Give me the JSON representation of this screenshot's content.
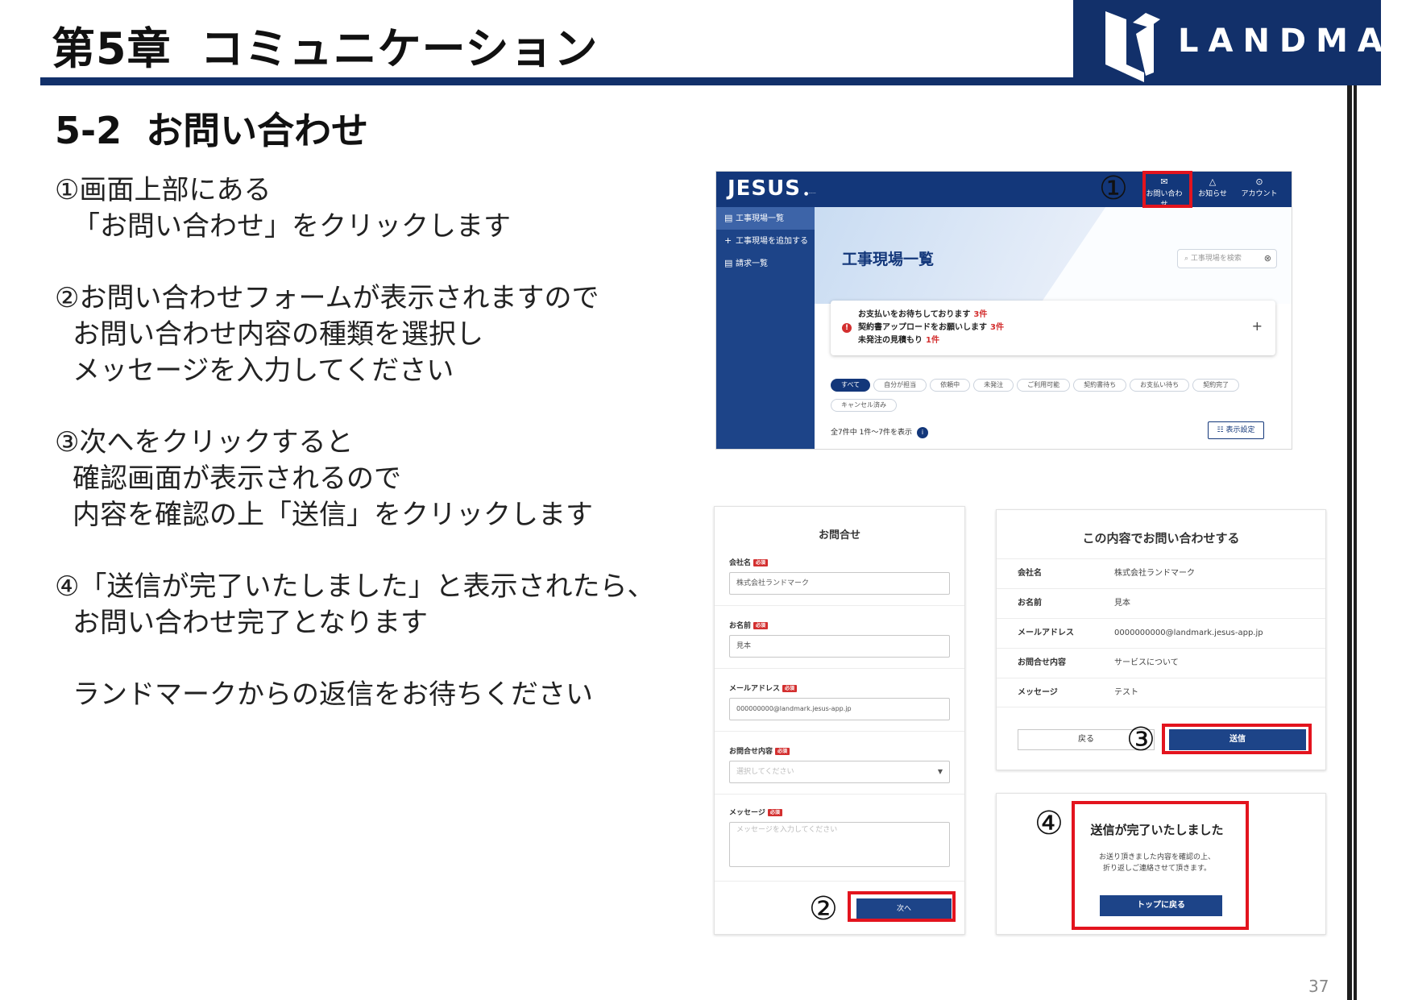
{
  "header": {
    "chapter_no": "第5章",
    "chapter_title": "コミュニケーション",
    "logo_text": "LANDMARK"
  },
  "section": {
    "no": "5-2",
    "title": "お問い合わせ"
  },
  "steps": [
    {
      "lines": [
        "①画面上部にある",
        "「お問い合わせ」をクリックします"
      ]
    },
    {
      "lines": [
        "②お問い合わせフォームが表示されますので",
        "お問い合わせ内容の種類を選択し",
        "メッセージを入力してください"
      ]
    },
    {
      "lines": [
        "③次へをクリックすると",
        "確認画面が表示されるので",
        "内容を確認の上「送信」をクリックします"
      ]
    },
    {
      "lines": [
        "④「送信が完了いたしました」と表示されたら、",
        "お問い合わせ完了となります"
      ]
    },
    {
      "lines": [
        "ランドマークからの返信をお待ちください"
      ]
    }
  ],
  "markers": {
    "m1": "①",
    "m2": "②",
    "m3": "③",
    "m4": "④"
  },
  "app": {
    "logo": "JESUS",
    "nav": [
      {
        "icon": "mail-icon",
        "glyph": "✉",
        "label": "お問い合わせ"
      },
      {
        "icon": "bell-icon",
        "glyph": "♫",
        "label": "お知らせ"
      },
      {
        "icon": "account-icon",
        "glyph": "⊙",
        "label": "アカウント"
      }
    ],
    "sidebar": [
      {
        "glyph": "▤",
        "label": "工事現場一覧"
      },
      {
        "glyph": "+",
        "label": "工事現場を追加する"
      },
      {
        "glyph": "▤",
        "label": "請求一覧"
      }
    ],
    "page_title": "工事現場一覧",
    "search_placeholder": "工事現場を検索",
    "alert": {
      "lines": [
        {
          "text": "お支払いをお待ちしております",
          "count": "3件"
        },
        {
          "text": "契約書アップロードをお願いします",
          "count": "3件"
        },
        {
          "text": "未発注の見積もり",
          "count": "1件"
        }
      ]
    },
    "chips": [
      "すべて",
      "自分が担当",
      "依頼中",
      "未発注",
      "ご利用可能",
      "契約書待ち",
      "お支払い待ち",
      "契約完了",
      "キャンセル済み"
    ],
    "count_text": "全7件中 1件〜7件を表示",
    "count_badge": "i",
    "display_settings": "☷ 表示設定"
  },
  "form": {
    "title": "お問合せ",
    "required": "必須",
    "company_label": "会社名",
    "company_value": "株式会社ランドマーク",
    "name_label": "お名前",
    "name_value": "見本",
    "email_label": "メールアドレス",
    "email_value": "000000000@landmark.jesus-app.jp",
    "type_label": "お問合せ内容",
    "type_placeholder": "選択してください",
    "message_label": "メッセージ",
    "message_placeholder": "メッセージを入力してください",
    "next_button": "次へ"
  },
  "confirm": {
    "title": "この内容でお問い合わせする",
    "rows": [
      {
        "k": "会社名",
        "v": "株式会社ランドマーク"
      },
      {
        "k": "お名前",
        "v": "見本"
      },
      {
        "k": "メールアドレス",
        "v": "0000000000@landmark.jesus-app.jp"
      },
      {
        "k": "お問合せ内容",
        "v": "サービスについて"
      },
      {
        "k": "メッセージ",
        "v": "テスト"
      }
    ],
    "back_button": "戻る",
    "send_button": "送信"
  },
  "done": {
    "title": "送信が完了いたしました",
    "msg1": "お送り頂きました内容を確認の上、",
    "msg2": "折り返しご連絡させて頂きます。",
    "top_button": "トップに戻る"
  },
  "page_number": "37",
  "colors": {
    "navy": "#12306a",
    "app_blue": "#13377a",
    "highlight_red": "#e3141e"
  }
}
